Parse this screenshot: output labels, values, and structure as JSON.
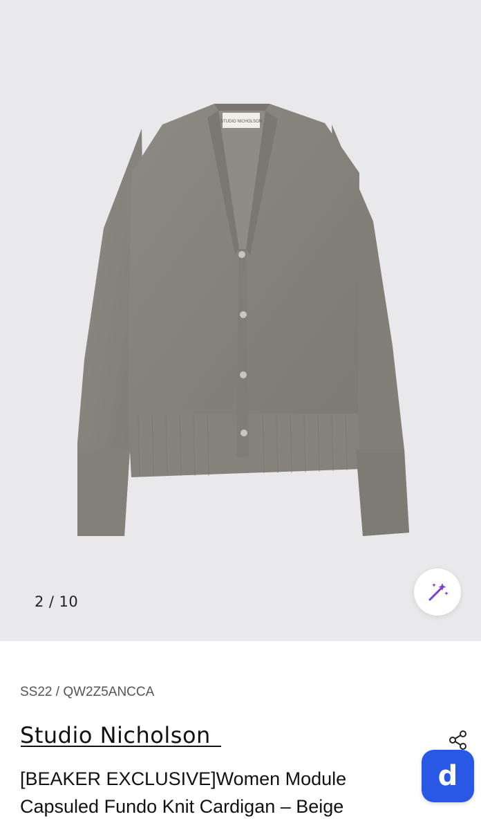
{
  "gallery": {
    "current": "2",
    "separator": "/",
    "total": "10",
    "image_alt": "grey v-neck knit cardigan",
    "label_text": "STUDIO NICHOLSON"
  },
  "product": {
    "sku": "SS22 / QW2Z5ANCCA",
    "brand": "Studio Nicholson",
    "title_line1": "[BEAKER EXCLUSIVE]Women Module",
    "title_line2": "Capsuled Fundo Knit Cardigan – Beige"
  },
  "buttons": {
    "magic": "magic-wand-icon",
    "share": "share-icon",
    "app_label": "d"
  },
  "colors": {
    "background_gallery": "#e9e9eb",
    "cardigan": "#8a8680",
    "magic_accent": "#7a3fd0",
    "app_button": "#2a58e6"
  }
}
